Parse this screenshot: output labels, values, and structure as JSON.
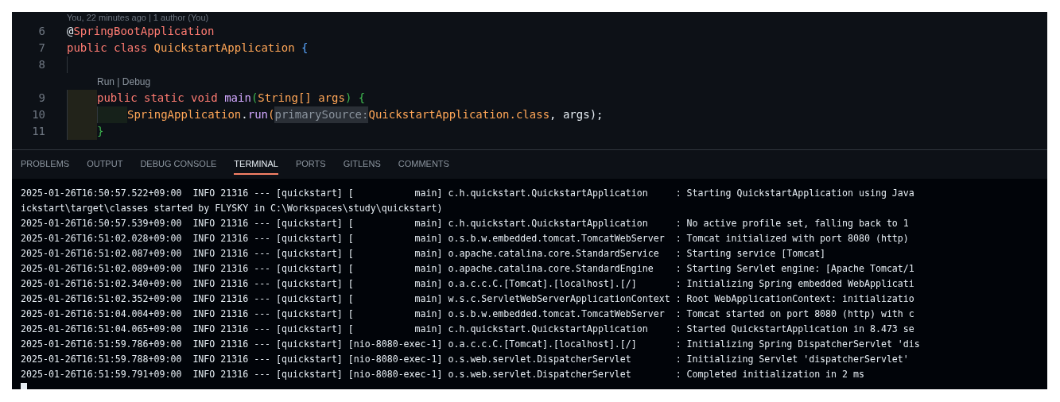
{
  "editor": {
    "blame": "You, 22 minutes ago | 1 author (You)",
    "lines": [
      {
        "number": "6",
        "tokens": [
          {
            "kind": "plain",
            "text": "@"
          },
          {
            "kind": "annotation",
            "text": "SpringBootApplication"
          }
        ]
      },
      {
        "number": "7",
        "tokens": [
          {
            "kind": "keyword",
            "text": "public class "
          },
          {
            "kind": "type",
            "text": "QuickstartApplication "
          },
          {
            "kind": "brace",
            "text": "{"
          }
        ]
      },
      {
        "number": "8",
        "tokens": [
          {
            "kind": "indent"
          }
        ]
      },
      {
        "codelens": "Run | Debug",
        "number": "9",
        "tokens": [
          {
            "kind": "indent",
            "color": "#22231a"
          },
          {
            "kind": "keyword",
            "text": "public static void "
          },
          {
            "kind": "func",
            "text": "main"
          },
          {
            "kind": "paren",
            "text": "("
          },
          {
            "kind": "type",
            "text": "String[] args"
          },
          {
            "kind": "paren",
            "text": ") {"
          }
        ]
      },
      {
        "number": "10",
        "tokens": [
          {
            "kind": "indent",
            "color": "#22231a"
          },
          {
            "kind": "indent",
            "color": "#16211a"
          },
          {
            "kind": "type",
            "text": "SpringApplication"
          },
          {
            "kind": "plain",
            "text": "."
          },
          {
            "kind": "func",
            "text": "run"
          },
          {
            "kind": "type",
            "text": "("
          },
          {
            "kind": "hint",
            "text": "primarySource:"
          },
          {
            "kind": "type",
            "text": "QuickstartApplication.class"
          },
          {
            "kind": "plain",
            "text": ", args);"
          }
        ]
      },
      {
        "number": "11",
        "tokens": [
          {
            "kind": "indent",
            "color": "#22231a"
          },
          {
            "kind": "paren",
            "text": "}"
          }
        ]
      }
    ]
  },
  "panel_tabs": [
    {
      "label": "PROBLEMS",
      "selected": false
    },
    {
      "label": "OUTPUT",
      "selected": false
    },
    {
      "label": "DEBUG CONSOLE",
      "selected": false
    },
    {
      "label": "TERMINAL",
      "selected": true
    },
    {
      "label": "PORTS",
      "selected": false
    },
    {
      "label": "GITLENS",
      "selected": false
    },
    {
      "label": "COMMENTS",
      "selected": false
    }
  ],
  "terminal": {
    "lines": [
      "2025-01-26T16:50:57.522+09:00  INFO 21316 --- [quickstart] [           main] c.h.quickstart.QuickstartApplication     : Starting QuickstartApplication using Java",
      "ickstart\\target\\classes started by FLYSKY in C:\\Workspaces\\study\\quickstart)",
      "2025-01-26T16:50:57.539+09:00  INFO 21316 --- [quickstart] [           main] c.h.quickstart.QuickstartApplication     : No active profile set, falling back to 1",
      "2025-01-26T16:51:02.028+09:00  INFO 21316 --- [quickstart] [           main] o.s.b.w.embedded.tomcat.TomcatWebServer  : Tomcat initialized with port 8080 (http)",
      "2025-01-26T16:51:02.087+09:00  INFO 21316 --- [quickstart] [           main] o.apache.catalina.core.StandardService   : Starting service [Tomcat]",
      "2025-01-26T16:51:02.089+09:00  INFO 21316 --- [quickstart] [           main] o.apache.catalina.core.StandardEngine    : Starting Servlet engine: [Apache Tomcat/1",
      "2025-01-26T16:51:02.340+09:00  INFO 21316 --- [quickstart] [           main] o.a.c.c.C.[Tomcat].[localhost].[/]       : Initializing Spring embedded WebApplicati",
      "2025-01-26T16:51:02.352+09:00  INFO 21316 --- [quickstart] [           main] w.s.c.ServletWebServerApplicationContext : Root WebApplicationContext: initializatio",
      "2025-01-26T16:51:04.004+09:00  INFO 21316 --- [quickstart] [           main] o.s.b.w.embedded.tomcat.TomcatWebServer  : Tomcat started on port 8080 (http) with c",
      "2025-01-26T16:51:04.065+09:00  INFO 21316 --- [quickstart] [           main] c.h.quickstart.QuickstartApplication     : Started QuickstartApplication in 8.473 se",
      "2025-01-26T16:51:59.786+09:00  INFO 21316 --- [quickstart] [nio-8080-exec-1] o.a.c.c.C.[Tomcat].[localhost].[/]       : Initializing Spring DispatcherServlet 'dis",
      "2025-01-26T16:51:59.788+09:00  INFO 21316 --- [quickstart] [nio-8080-exec-1] o.s.web.servlet.DispatcherServlet        : Initializing Servlet 'dispatcherServlet'",
      "2025-01-26T16:51:59.791+09:00  INFO 21316 --- [quickstart] [nio-8080-exec-1] o.s.web.servlet.DispatcherServlet        : Completed initialization in 2 ms"
    ]
  }
}
